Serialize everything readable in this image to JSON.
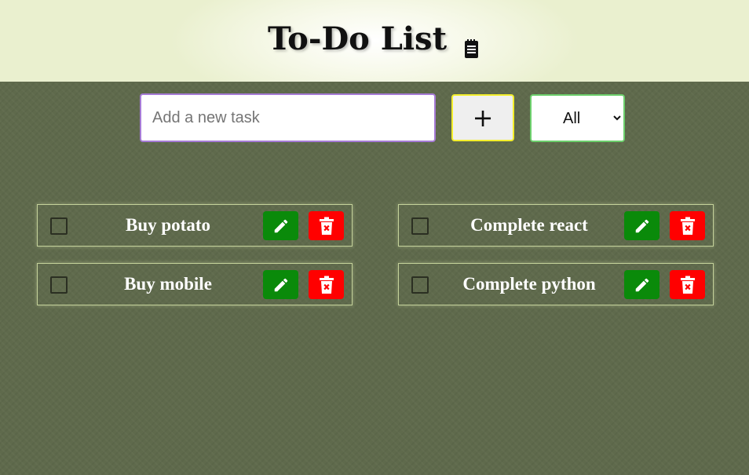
{
  "header": {
    "title": "To-Do List",
    "title_icon": "notepad-icon"
  },
  "controls": {
    "input_placeholder": "Add a new task",
    "input_value": "",
    "add_label": "+",
    "filter_options": [
      "All"
    ],
    "filter_selected": "All"
  },
  "tasks": [
    {
      "label": "Buy potato",
      "completed": false
    },
    {
      "label": "Complete react",
      "completed": false
    },
    {
      "label": "Buy mobile",
      "completed": false
    },
    {
      "label": "Complete python",
      "completed": false
    }
  ],
  "icons": {
    "edit": "pencil-icon",
    "delete": "trash-icon"
  },
  "colors": {
    "background": "#5f6a4c",
    "edit_button": "#0a8a0a",
    "delete_button": "#ff0000",
    "input_border": "#a67bd6",
    "add_border": "#f3ee2b",
    "filter_border": "#6ccf6c",
    "task_border": "#c4d29a"
  }
}
